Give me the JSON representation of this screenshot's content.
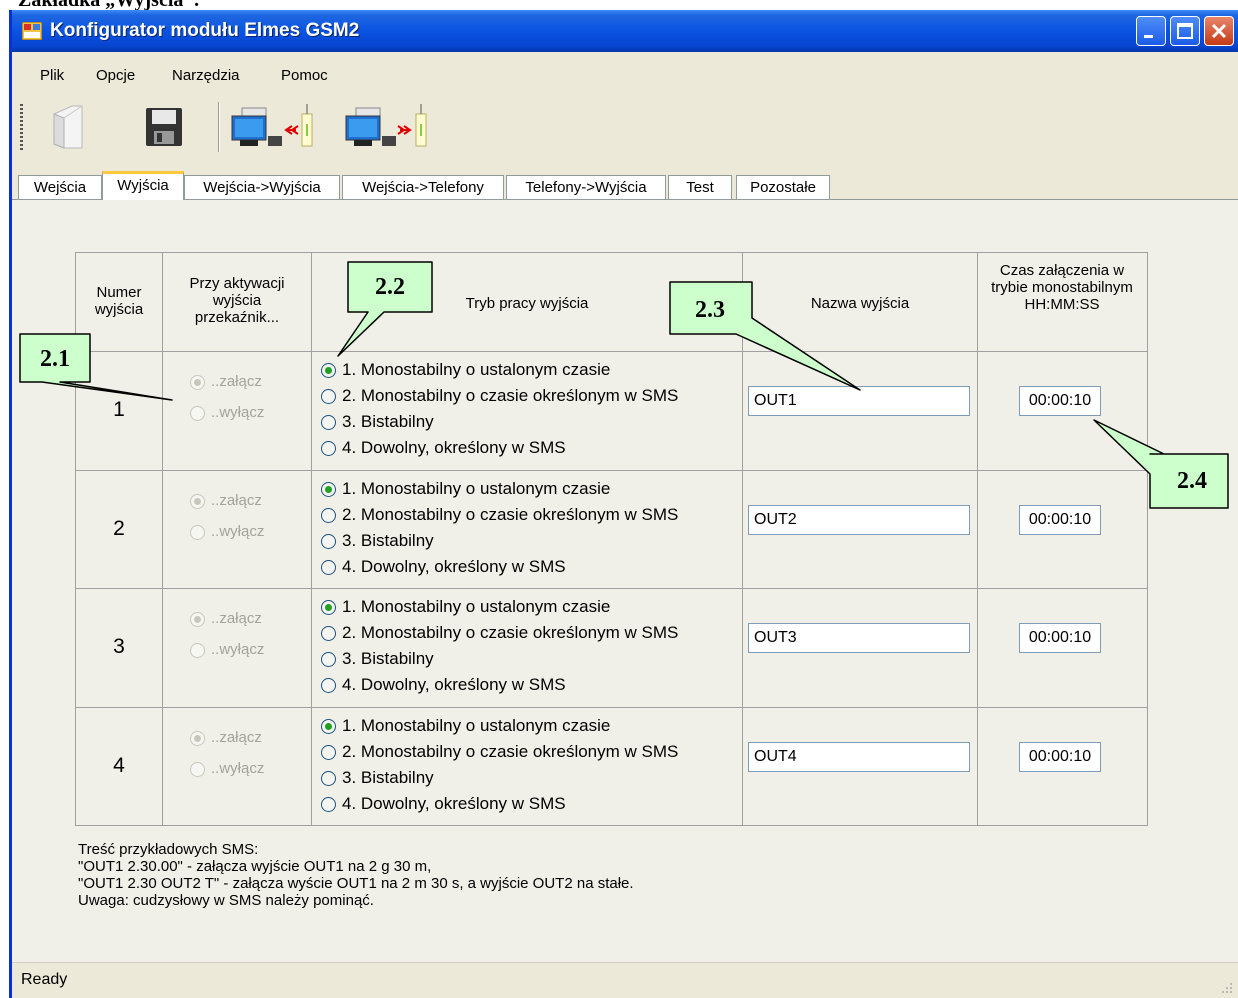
{
  "document": {
    "heading": "Zakładka „Wyjścia”:"
  },
  "window": {
    "title": "Konfigurator modułu Elmes GSM2",
    "controls": {
      "minimize_icon": "minimize-icon",
      "maximize_icon": "maximize-icon",
      "close_icon": "close-icon"
    }
  },
  "menu": {
    "items": [
      "Plik",
      "Opcje",
      "Narzędzia",
      "Pomoc"
    ]
  },
  "toolbar": {
    "buttons": [
      {
        "name": "open-file-icon"
      },
      {
        "name": "save-floppy-icon"
      },
      {
        "name": "read-from-module-icon"
      },
      {
        "name": "write-to-module-icon"
      }
    ]
  },
  "tabs": {
    "items": [
      "Wejścia",
      "Wyjścia",
      "Wejścia->Wyjścia",
      "Wejścia->Telefony",
      "Telefony->Wyjścia",
      "Test",
      "Pozostałe"
    ],
    "active": "Wyjścia"
  },
  "outputs_table": {
    "headers": {
      "number": "Numer wyjścia",
      "relay_action": "Przy aktywacji wyjścia przekaźnik...",
      "mode": "Tryb pracy wyjścia",
      "name": "Nazwa wyjścia",
      "time": "Czas załączenia w trybie monostabilnym HH:MM:SS"
    },
    "relay_options": [
      "..załącz",
      "..wyłącz"
    ],
    "mode_options": [
      "1. Monostabilny o ustalonym czasie",
      "2. Monostabilny o czasie określonym w SMS",
      "3. Bistabilny",
      "4. Dowolny, określony w SMS"
    ],
    "rows": [
      {
        "number": "1",
        "relay_selected": 0,
        "mode_selected": 0,
        "name": "OUT1",
        "time": "00:00:10"
      },
      {
        "number": "2",
        "relay_selected": 0,
        "mode_selected": 0,
        "name": "OUT2",
        "time": "00:00:10"
      },
      {
        "number": "3",
        "relay_selected": 0,
        "mode_selected": 0,
        "name": "OUT3",
        "time": "00:00:10"
      },
      {
        "number": "4",
        "relay_selected": 0,
        "mode_selected": 0,
        "name": "OUT4",
        "time": "00:00:10"
      }
    ]
  },
  "notes": [
    "Treść przykładowych SMS:",
    "\"OUT1 2.30.00\" - załącza wyjście OUT1 na 2 g 30 m,",
    "\"OUT1 2.30 OUT2 T\" - załącza wyście OUT1 na 2 m 30 s, a wyjście OUT2 na stałe.",
    "Uwaga: cudzysłowy w SMS należy pominąć."
  ],
  "status": {
    "text": "Ready"
  },
  "callouts": [
    "2.1",
    "2.2",
    "2.3",
    "2.4"
  ],
  "colors": {
    "titlebar": "#0a54e3",
    "active_tab_accent": "#ffc83c",
    "callout_fill": "#ccffcc",
    "radio_checked": "#21a121"
  }
}
